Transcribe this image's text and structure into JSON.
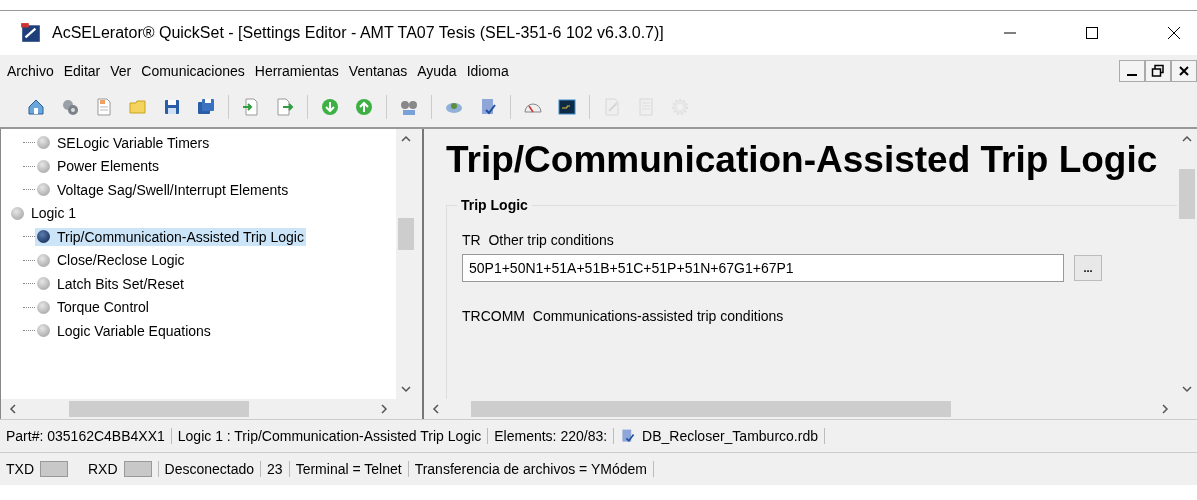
{
  "window": {
    "title": "AcSELerator® QuickSet - [Settings Editor - AMT TA07 Tesis (SEL-351-6 102 v6.3.0.7)]"
  },
  "menu": [
    "Archivo",
    "Editar",
    "Ver",
    "Comunicaciones",
    "Herramientas",
    "Ventanas",
    "Ayuda",
    "Idioma"
  ],
  "toolbar": [
    [
      {
        "disabled": false
      },
      {
        "disabled": false
      },
      {
        "disabled": false
      },
      {
        "disabled": false
      },
      {
        "disabled": false
      },
      {
        "disabled": false
      }
    ],
    [
      {
        "disabled": false
      },
      {
        "disabled": false
      }
    ],
    [
      {
        "disabled": false
      },
      {
        "disabled": false
      }
    ],
    [
      {
        "disabled": false
      }
    ],
    [
      {
        "disabled": false
      },
      {
        "disabled": false
      }
    ],
    [
      {
        "disabled": false
      },
      {
        "disabled": false
      }
    ],
    [
      {
        "disabled": true
      },
      {
        "disabled": true
      },
      {
        "disabled": true
      }
    ]
  ],
  "tree": {
    "items": [
      {
        "children": [
          {
            "label": "SELogic Variable Timers",
            "selected": false
          },
          {
            "label": "Power Elements",
            "selected": false
          },
          {
            "label": "Voltage Sag/Swell/Interrupt Elements",
            "selected": false
          }
        ]
      },
      {
        "label": "Logic 1",
        "children": [
          {
            "label": "Trip/Communication-Assisted Trip Logic",
            "selected": true
          },
          {
            "label": "Close/Reclose Logic",
            "selected": false
          },
          {
            "label": "Latch Bits Set/Reset",
            "selected": false
          },
          {
            "label": "Torque Control",
            "selected": false
          },
          {
            "label": "Logic Variable Equations",
            "selected": false
          }
        ]
      }
    ]
  },
  "editor": {
    "heading": "Trip/Communication-Assisted Trip Logic",
    "group": "Trip Logic",
    "settings": [
      {
        "code": "TR",
        "label": "Other trip conditions",
        "value": "50P1+50N1+51A+51B+51C+51P+51N+67G1+67P1",
        "button": "..."
      },
      {
        "code": "TRCOMM",
        "label": "Communications-assisted trip conditions"
      }
    ]
  },
  "status_bar": {
    "row_1": [
      "Part#: 035162C4BB4XX1",
      "Logic 1 : Trip/Communication-Assisted Trip Logic",
      "Elements: 220/83:"
    ],
    "file": "DB_Recloser_Tamburco.rdb",
    "row_2": {
      "txd": "TXD",
      "rxd": "RXD",
      "connection": "Desconectado",
      "port": "23",
      "terminal": "Terminal = Telnet",
      "transfer": "Transferencia de archivos = YMódem"
    }
  }
}
